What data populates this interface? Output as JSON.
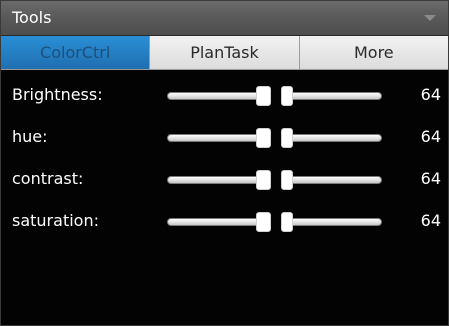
{
  "panel": {
    "title": "Tools"
  },
  "tabs": [
    {
      "label": "ColorCtrl",
      "active": true
    },
    {
      "label": "PlanTask",
      "active": false
    },
    {
      "label": "More",
      "active": false
    }
  ],
  "controls": [
    {
      "label": "Brightness:",
      "value": "64",
      "level": 0.5
    },
    {
      "label": "hue:",
      "value": "64",
      "level": 0.5
    },
    {
      "label": "contrast:",
      "value": "64",
      "level": 0.5
    },
    {
      "label": "saturation:",
      "value": "64",
      "level": 0.5
    }
  ],
  "colors": {
    "active_tab": "#1f7ac4",
    "background": "#030303",
    "text": "#ffffff"
  }
}
